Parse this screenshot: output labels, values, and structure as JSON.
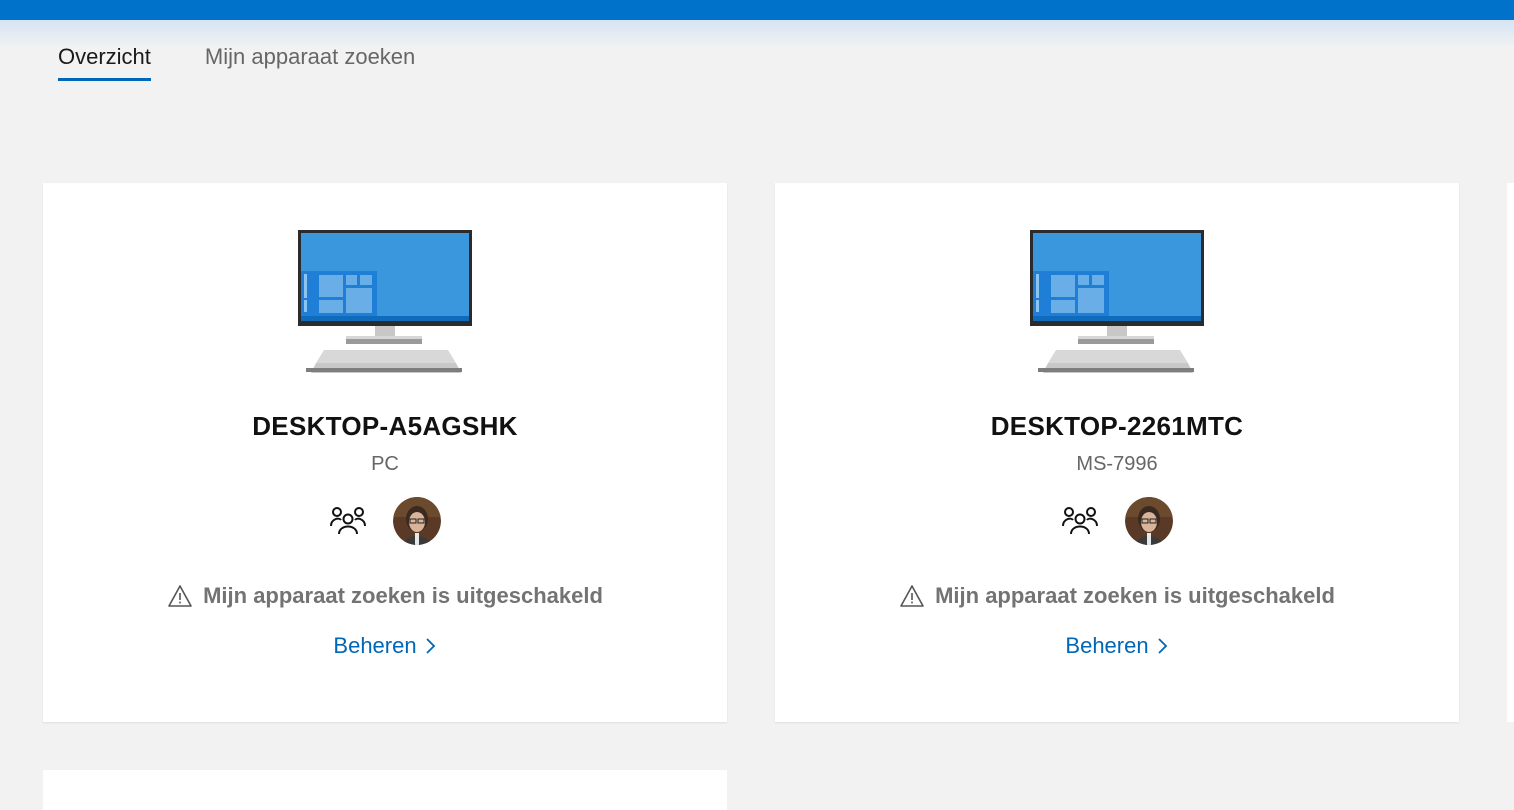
{
  "tabs": [
    {
      "label": "Overzicht",
      "active": true
    },
    {
      "label": "Mijn apparaat zoeken",
      "active": false
    }
  ],
  "devices": [
    {
      "name": "DESKTOP-A5AGSHK",
      "model": "PC",
      "warning": "Mijn apparaat zoeken is uitgeschakeld",
      "manage_label": "Beheren"
    },
    {
      "name": "DESKTOP-2261MTC",
      "model": "MS-7996",
      "warning": "Mijn apparaat zoeken is uitgeschakeld",
      "manage_label": "Beheren"
    }
  ],
  "colors": {
    "accent": "#0067b8",
    "topbar": "#0072c9",
    "background": "#f2f2f2",
    "screen": "#3a96dd"
  },
  "icons": {
    "family": "family-group-icon",
    "warning": "warning-triangle-icon",
    "chevron": "chevron-right-icon",
    "device": "desktop-monitor-icon"
  }
}
